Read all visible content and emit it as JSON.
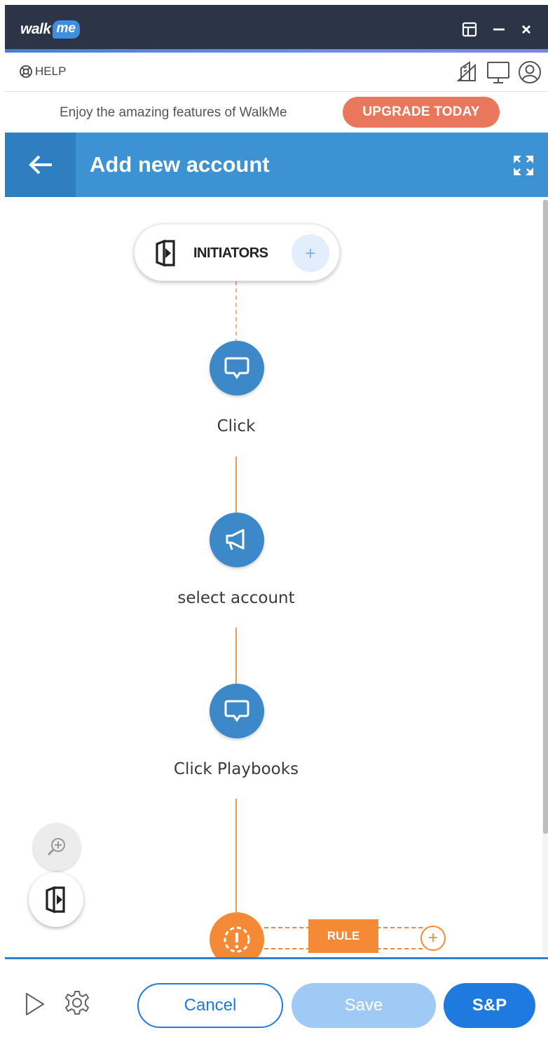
{
  "app": {
    "logo_walk": "walk",
    "logo_me": "me",
    "window_buttons": [
      "layout-icon",
      "minimize-icon",
      "close-icon"
    ]
  },
  "helpbar": {
    "help_label": "HELP",
    "icons": [
      "gallery-icon",
      "monitor-icon",
      "user-icon"
    ]
  },
  "upgrade": {
    "message": "Enjoy the amazing features of WalkMe",
    "button_label": "UPGRADE TODAY"
  },
  "header": {
    "title": "Add new account"
  },
  "flow": {
    "initiators_label": "INITIATORS",
    "steps": [
      {
        "label": "Click",
        "icon": "speech-bubble-icon"
      },
      {
        "label": "select account",
        "icon": "megaphone-icon"
      },
      {
        "label": "Click Playbooks",
        "icon": "speech-bubble-icon"
      }
    ],
    "rule_label": "RULE"
  },
  "footer": {
    "cancel_label": "Cancel",
    "save_label": "Save",
    "sp_label": "S&P"
  },
  "colors": {
    "titlebar": "#2c3547",
    "header": "#3d92d3",
    "node_blue": "#3d88c9",
    "rule_orange": "#f58a36",
    "upgrade_orange": "#e8775c",
    "primary": "#1f7ae0"
  }
}
